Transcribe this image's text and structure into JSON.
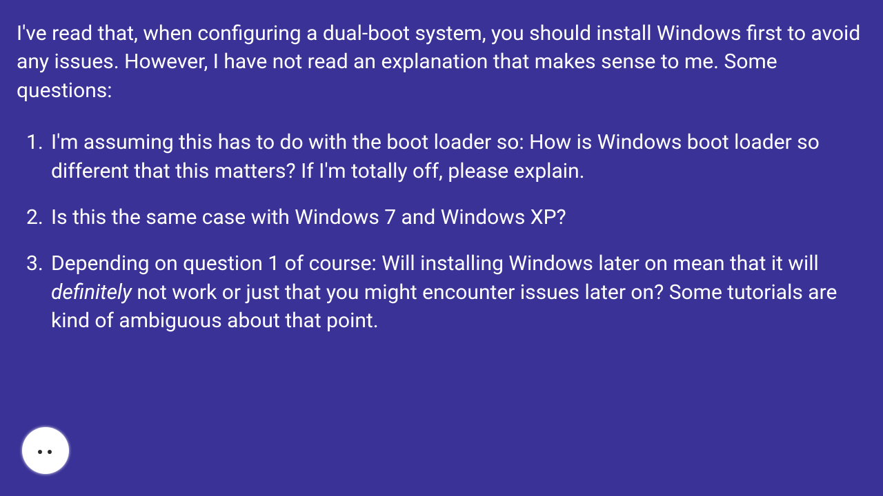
{
  "intro": "I've read that, when configuring a dual-boot system, you should install Windows first to avoid any issues. However, I have not read an explanation that makes sense to me. Some questions:",
  "questions": [
    {
      "text": "I'm assuming this has to do with the boot loader so: How is Windows boot loader so different that this matters? If I'm totally off, please explain."
    },
    {
      "text": "Is this the same case with Windows 7 and Windows XP?"
    },
    {
      "pre": "Depending on question 1 of course: Will installing Windows later on mean that it will ",
      "italic": "definitely",
      "post": " not work or just that you might encounter issues later on? Some tutorials are kind of ambiguous about that point."
    }
  ]
}
